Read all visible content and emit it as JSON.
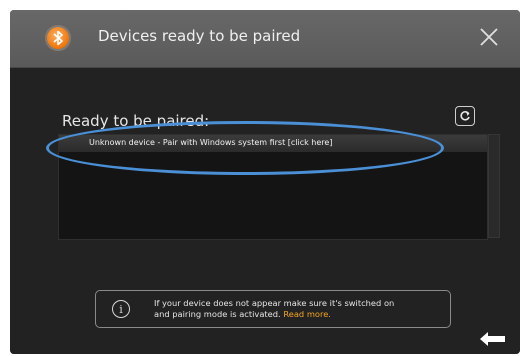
{
  "window": {
    "title": "Devices ready to be paired",
    "app_icon": "bluetooth-icon",
    "close_icon": "close-icon"
  },
  "list": {
    "label": "Ready to be paired:",
    "refresh_icon": "refresh-icon",
    "items": [
      {
        "label": "Unknown device - Pair with Windows system first [click here]"
      }
    ]
  },
  "info": {
    "icon": "info-icon",
    "line1": "If your device does not appear make sure it's switched on",
    "line2": "and pairing mode is activated.",
    "link": "Read more."
  },
  "footer": {
    "back_icon": "back-arrow-icon"
  },
  "colors": {
    "accent_orange": "#f07a10",
    "link": "#f5a623",
    "highlight": "#4b8fd6"
  }
}
